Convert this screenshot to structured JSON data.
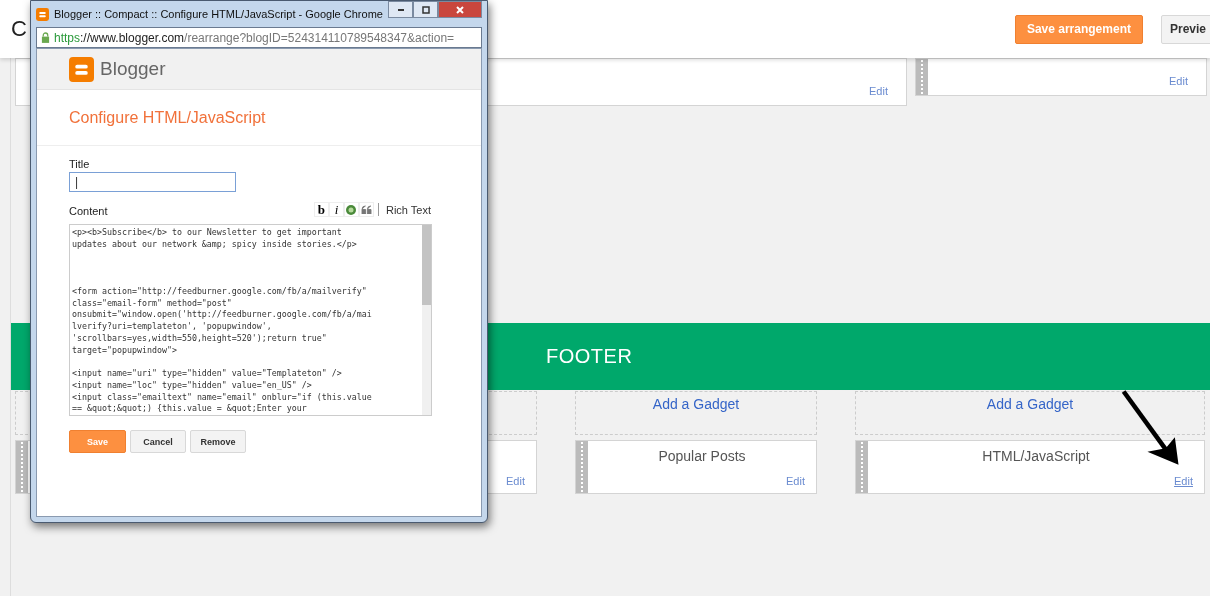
{
  "page": {
    "title": "C",
    "buttons": [
      {
        "label": "Save arrangement",
        "kind": "primary"
      },
      {
        "label": "Previe",
        "kind": "secondary"
      }
    ]
  },
  "top_gadgets": [
    {
      "edit": "Edit",
      "draggable": false
    },
    {
      "edit": "Edit",
      "draggable": true
    }
  ],
  "footer": {
    "heading": "FOOTER",
    "columns": [
      {
        "gadgets": [
          {
            "edit": "Edit",
            "hovered": false
          }
        ]
      },
      {
        "add_gadget": "Add a Gadget",
        "gadgets": [
          {
            "title": "Popular Posts",
            "edit": "Edit",
            "hovered": false
          }
        ]
      },
      {
        "add_gadget": "Add a Gadget",
        "gadgets": [
          {
            "title": "HTML/JavaScript",
            "edit": "Edit",
            "hovered": true
          }
        ]
      }
    ]
  },
  "popup": {
    "window_title": "Blogger :: Compact :: Configure HTML/JavaScript - Google Chrome",
    "url_scheme": "https",
    "url_host": "://www.blogger.com",
    "url_path": "/rearrange?blogID=524314110789548347&action=",
    "brand": "Blogger",
    "heading": "Configure HTML/JavaScript",
    "title_label": "Title",
    "title_value": "|",
    "content_label": "Content",
    "toolbar": [
      {
        "kind": "bold",
        "glyph": "b"
      },
      {
        "kind": "italic",
        "glyph": "i"
      },
      {
        "kind": "image"
      },
      {
        "kind": "quote"
      }
    ],
    "rich_text": "Rich Text",
    "content_blocks": [
      {
        "wide_gap": true,
        "lines": [
          "<p><b>Subscribe</b> to our Newsletter to get important",
          "updates about our network &amp; spicy inside stories.</p>"
        ]
      },
      {
        "wide_gap": false,
        "lines": [
          "<form action=\"http://feedburner.google.com/fb/a/mailverify\"",
          "class=\"email-form\" method=\"post\"",
          "onsubmit=\"window.open('http://feedburner.google.com/fb/a/mai",
          "lverify?uri=templateton', 'popupwindow',",
          "'scrollbars=yes,width=550,height=520');return true\"",
          "target=\"popupwindow\">"
        ]
      },
      {
        "lines": [
          "<input name=\"uri\" type=\"hidden\" value=\"Templateton\" />",
          "<input name=\"loc\" type=\"hidden\" value=\"en_US\" />",
          "<input class=\"emailtext\" name=\"email\" onblur=\"if (this.value",
          "== &quot;&quot;) {this.value = &quot;Enter your"
        ]
      }
    ],
    "buttons": [
      {
        "label": "Save",
        "kind": "primary"
      },
      {
        "label": "Cancel",
        "kind": "secondary"
      },
      {
        "label": "Remove",
        "kind": "secondary"
      }
    ]
  }
}
